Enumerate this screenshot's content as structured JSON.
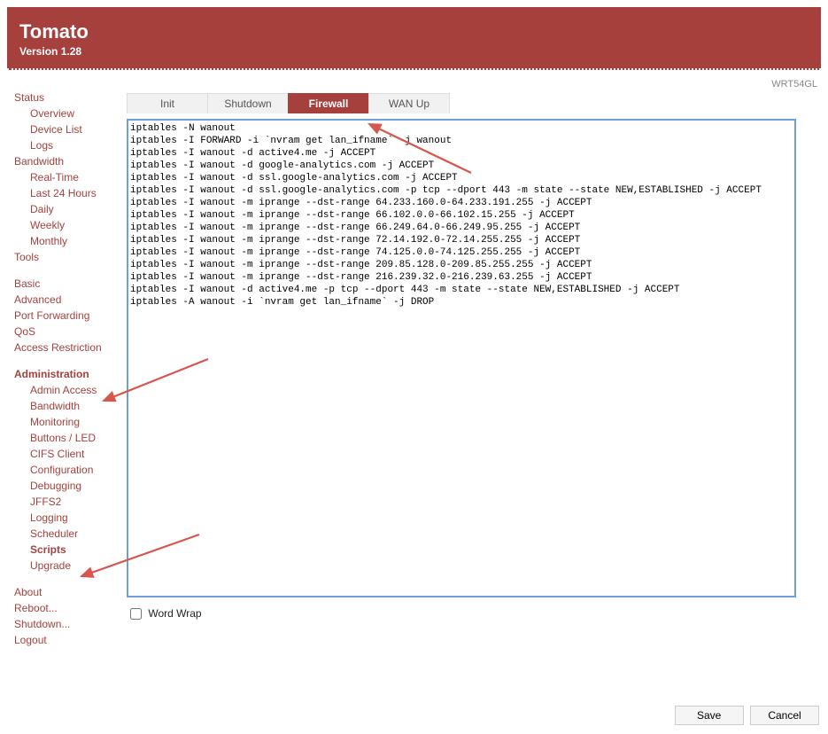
{
  "header": {
    "title": "Tomato",
    "version": "Version 1.28"
  },
  "model_label": "WRT54GL",
  "tabs": [
    {
      "label": "Init",
      "active": false
    },
    {
      "label": "Shutdown",
      "active": false
    },
    {
      "label": "Firewall",
      "active": true
    },
    {
      "label": "WAN Up",
      "active": false
    }
  ],
  "nav": {
    "sections": [
      {
        "label": "Status",
        "subs": [
          "Overview",
          "Device List",
          "Logs"
        ]
      },
      {
        "label": "Bandwidth",
        "subs": [
          "Real-Time",
          "Last 24 Hours",
          "Daily",
          "Weekly",
          "Monthly"
        ]
      },
      {
        "label": "Tools",
        "subs": []
      }
    ],
    "mid": [
      "Basic",
      "Advanced",
      "Port Forwarding",
      "QoS",
      "Access Restriction"
    ],
    "admin": {
      "label": "Administration",
      "subs": [
        "Admin Access",
        "Bandwidth Monitoring",
        "Buttons / LED",
        "CIFS Client",
        "Configuration",
        "Debugging",
        "JFFS2",
        "Logging",
        "Scheduler",
        "Scripts",
        "Upgrade"
      ],
      "active_sub": "Scripts"
    },
    "bottom": [
      "About",
      "Reboot...",
      "Shutdown...",
      "Logout"
    ]
  },
  "script_text": "iptables -N wanout\niptables -I FORWARD -i `nvram get lan_ifname` -j wanout\niptables -I wanout -d active4.me -j ACCEPT\niptables -I wanout -d google-analytics.com -j ACCEPT\niptables -I wanout -d ssl.google-analytics.com -j ACCEPT\niptables -I wanout -d ssl.google-analytics.com -p tcp --dport 443 -m state --state NEW,ESTABLISHED -j ACCEPT\niptables -I wanout -m iprange --dst-range 64.233.160.0-64.233.191.255 -j ACCEPT\niptables -I wanout -m iprange --dst-range 66.102.0.0-66.102.15.255 -j ACCEPT\niptables -I wanout -m iprange --dst-range 66.249.64.0-66.249.95.255 -j ACCEPT\niptables -I wanout -m iprange --dst-range 72.14.192.0-72.14.255.255 -j ACCEPT\niptables -I wanout -m iprange --dst-range 74.125.0.0-74.125.255.255 -j ACCEPT\niptables -I wanout -m iprange --dst-range 209.85.128.0-209.85.255.255 -j ACCEPT\niptables -I wanout -m iprange --dst-range 216.239.32.0-216.239.63.255 -j ACCEPT\niptables -I wanout -d active4.me -p tcp --dport 443 -m state --state NEW,ESTABLISHED -j ACCEPT\niptables -A wanout -i `nvram get lan_ifname` -j DROP",
  "wordwrap_label": "Word Wrap",
  "wordwrap_checked": false,
  "buttons": {
    "save": "Save",
    "cancel": "Cancel"
  }
}
